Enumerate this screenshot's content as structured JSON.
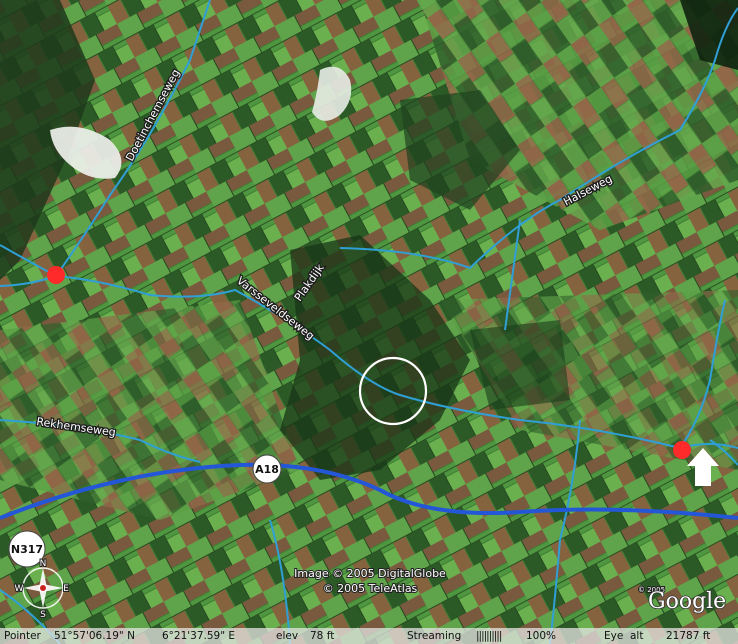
{
  "roads": {
    "doetinchemseweg": "Doetinchemseweg",
    "halseweg": "Halseweg",
    "plakdijk": "Plakdijk",
    "varsseveldseweg": "Varsseveldseweg",
    "rekhemseweg": "Rekhemseweg"
  },
  "shields": {
    "a18": "A18",
    "n317": "N317"
  },
  "compass": {
    "n": "N",
    "s": "S",
    "e": "E",
    "w": "W"
  },
  "credits": {
    "image": "Image © 2005 DigitalGlobe",
    "atlas": "© 2005 TeleAtlas",
    "small": "© 2005",
    "logo": "Google"
  },
  "status": {
    "pointer_label": "Pointer",
    "lat": "51°57'06.19\" N",
    "lon": "6°21'37.59\" E",
    "elev_label": "elev",
    "elev": "78 ft",
    "streaming_label": "Streaming",
    "streaming_bar": "||||||||||",
    "streaming_pct": "100%",
    "eye_label": "Eye  alt",
    "eye_alt": "21787 ft"
  },
  "colors": {
    "road_minor": "#2f9fd6",
    "road_highway": "#2457d8",
    "marker": "#ff2a2a"
  }
}
